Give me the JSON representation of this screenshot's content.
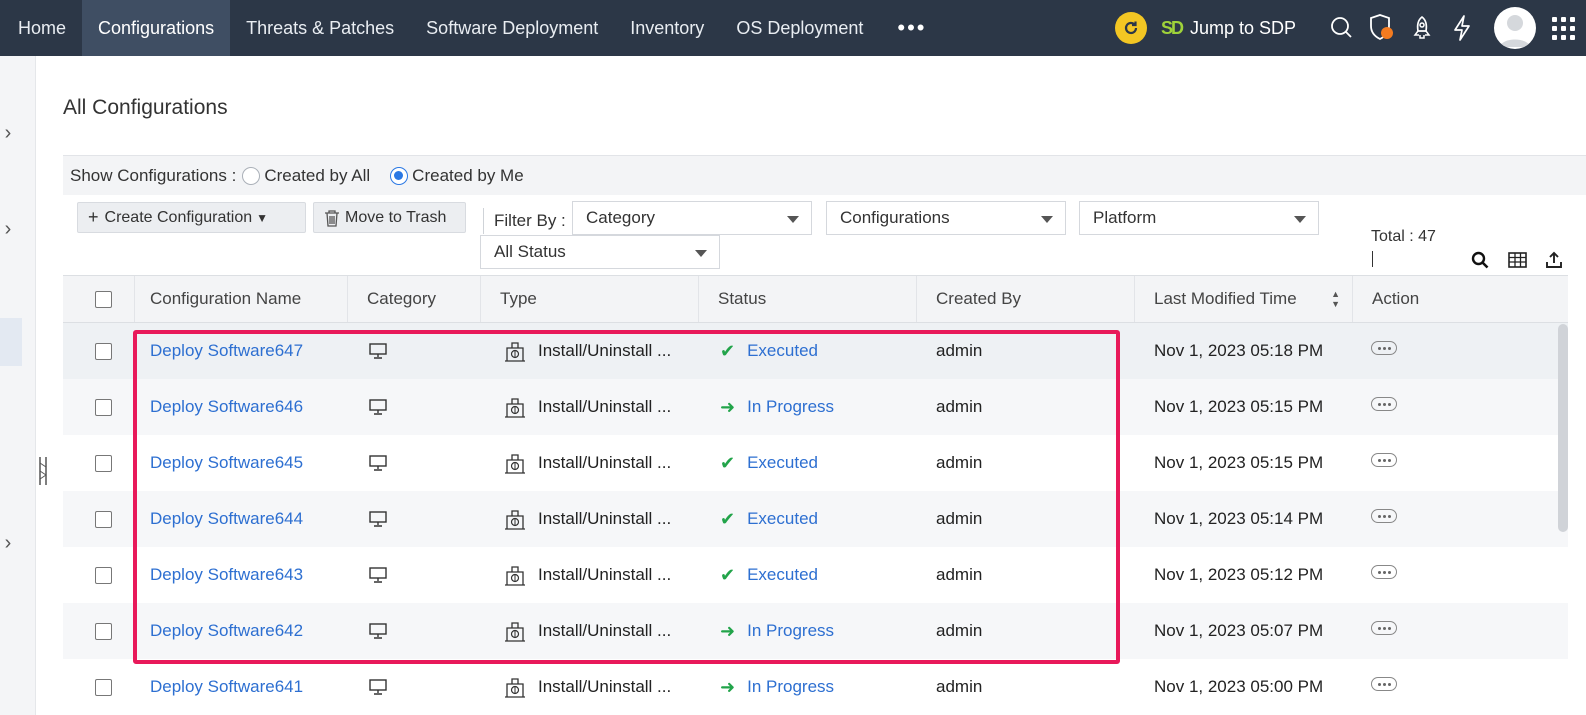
{
  "nav": {
    "items": [
      {
        "label": "Home",
        "active": false
      },
      {
        "label": "Configurations",
        "active": true
      },
      {
        "label": "Threats & Patches",
        "active": false
      },
      {
        "label": "Software Deployment",
        "active": false
      },
      {
        "label": "Inventory",
        "active": false
      },
      {
        "label": "OS Deployment",
        "active": false
      }
    ],
    "more": "•••",
    "jump_label": "Jump to SDP",
    "icons": [
      "sync-icon",
      "search-icon",
      "shield-alert-icon",
      "rocket-icon",
      "lightning-icon",
      "avatar",
      "apps-grid-icon"
    ]
  },
  "page": {
    "title": "All Configurations"
  },
  "show_bar": {
    "label": "Show Configurations :",
    "option_all": "Created by All",
    "option_me": "Created by Me",
    "selected": "Created by Me"
  },
  "toolbar": {
    "create_label": "Create Configuration",
    "trash_label": "Move to Trash",
    "filter_label": "Filter By :",
    "filter_category": "Category",
    "filter_configurations": "Configurations",
    "filter_platform": "Platform",
    "filter_status": "All Status",
    "total": "Total : 47"
  },
  "table": {
    "headers": [
      "Configuration Name",
      "Category",
      "Type",
      "Status",
      "Created By",
      "Last Modified Time",
      "Action"
    ],
    "rows": [
      {
        "name": "Deploy Software647",
        "type": "Install/Uninstall ...",
        "status": "Executed",
        "created_by": "admin",
        "modified": "Nov 1, 2023 05:18 PM"
      },
      {
        "name": "Deploy Software646",
        "type": "Install/Uninstall ...",
        "status": "In Progress",
        "created_by": "admin",
        "modified": "Nov 1, 2023 05:15 PM"
      },
      {
        "name": "Deploy Software645",
        "type": "Install/Uninstall ...",
        "status": "Executed",
        "created_by": "admin",
        "modified": "Nov 1, 2023 05:15 PM"
      },
      {
        "name": "Deploy Software644",
        "type": "Install/Uninstall ...",
        "status": "Executed",
        "created_by": "admin",
        "modified": "Nov 1, 2023 05:14 PM"
      },
      {
        "name": "Deploy Software643",
        "type": "Install/Uninstall ...",
        "status": "Executed",
        "created_by": "admin",
        "modified": "Nov 1, 2023 05:12 PM"
      },
      {
        "name": "Deploy Software642",
        "type": "Install/Uninstall ...",
        "status": "In Progress",
        "created_by": "admin",
        "modified": "Nov 1, 2023 05:07 PM"
      },
      {
        "name": "Deploy Software641",
        "type": "Install/Uninstall ...",
        "status": "In Progress",
        "created_by": "admin",
        "modified": "Nov 1, 2023 05:00 PM"
      }
    ]
  },
  "colors": {
    "nav_bg": "#2c3747",
    "nav_active": "#3f4e63",
    "link": "#2d6fd1",
    "success": "#22a44a",
    "highlight": "#e8195a",
    "sync": "#f3c623"
  }
}
